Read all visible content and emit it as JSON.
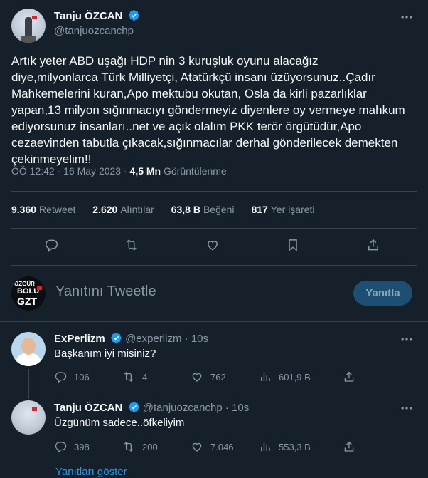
{
  "tweet": {
    "author_name": "Tanju ÖZCAN",
    "author_handle": "@tanjuozcanchp",
    "text": "Artık yeter ABD uşağı HDP nin 3 kuruşluk oyunu alacağız\ndiye,milyonlarca Türk Milliyetçi, Atatürkçü insanı üzüyorsunuz..Çadır\nMahkemelerini kuran,Apo mektubu okutan, Osla da kirli pazarlıklar\nyapan,13 milyon sığınmacıyı göndermeyiz diyenlere oy vermeye mahkum\nediyorsunuz insanları..net ve açık olalım PKK terör örgütüdür,Apo\ncezaevinden tabutla çıkacak,sığınmacılar derhal gönderilecek demekten\nçekinmeyelim!!",
    "time": "ÖÖ 12:42 · 16 May 2023 · ",
    "views_count": "4,5 Mn",
    "views_label": " Görüntülenme",
    "stats": {
      "retweets_count": "9.360",
      "retweets_label": "Retweet",
      "quotes_count": "2.620",
      "quotes_label": "Alıntılar",
      "likes_count": "63,8 B",
      "likes_label": "Beğeni",
      "bookmarks_count": "817",
      "bookmarks_label": "Yer işareti"
    }
  },
  "reply_box": {
    "avatar_text_top": "ÖZGÜR",
    "avatar_text_mid": "BOLU",
    "avatar_text_bot": "GZT",
    "placeholder": "Yanıtını Tweetle",
    "button": "Yanıtla"
  },
  "replies": [
    {
      "name": "ExPerlizm",
      "handle": "@experlizm",
      "time": " · 10s",
      "text": "Başkanım iyi misiniz?",
      "replies": "106",
      "retweets": "4",
      "likes": "762",
      "views": "601,9 B"
    },
    {
      "name": "Tanju ÖZCAN",
      "handle": "@tanjuozcanchp",
      "time": " · 10s",
      "text": "Üzgünüm sadece..öfkeliyim",
      "replies": "398",
      "retweets": "200",
      "likes": "7.046",
      "views": "553,3 B"
    }
  ],
  "show_replies": "Yanıtları göster",
  "icons": {
    "verified": "verified-badge-icon",
    "more": "more-dots-icon",
    "reply": "reply-icon",
    "retweet": "retweet-icon",
    "like": "heart-icon",
    "bookmark": "bookmark-icon",
    "share": "share-icon",
    "views": "views-chart-icon"
  },
  "colors": {
    "background": "#15202b",
    "accent": "#1d9bf0",
    "muted": "#8b98a5",
    "divider": "#38444d"
  }
}
